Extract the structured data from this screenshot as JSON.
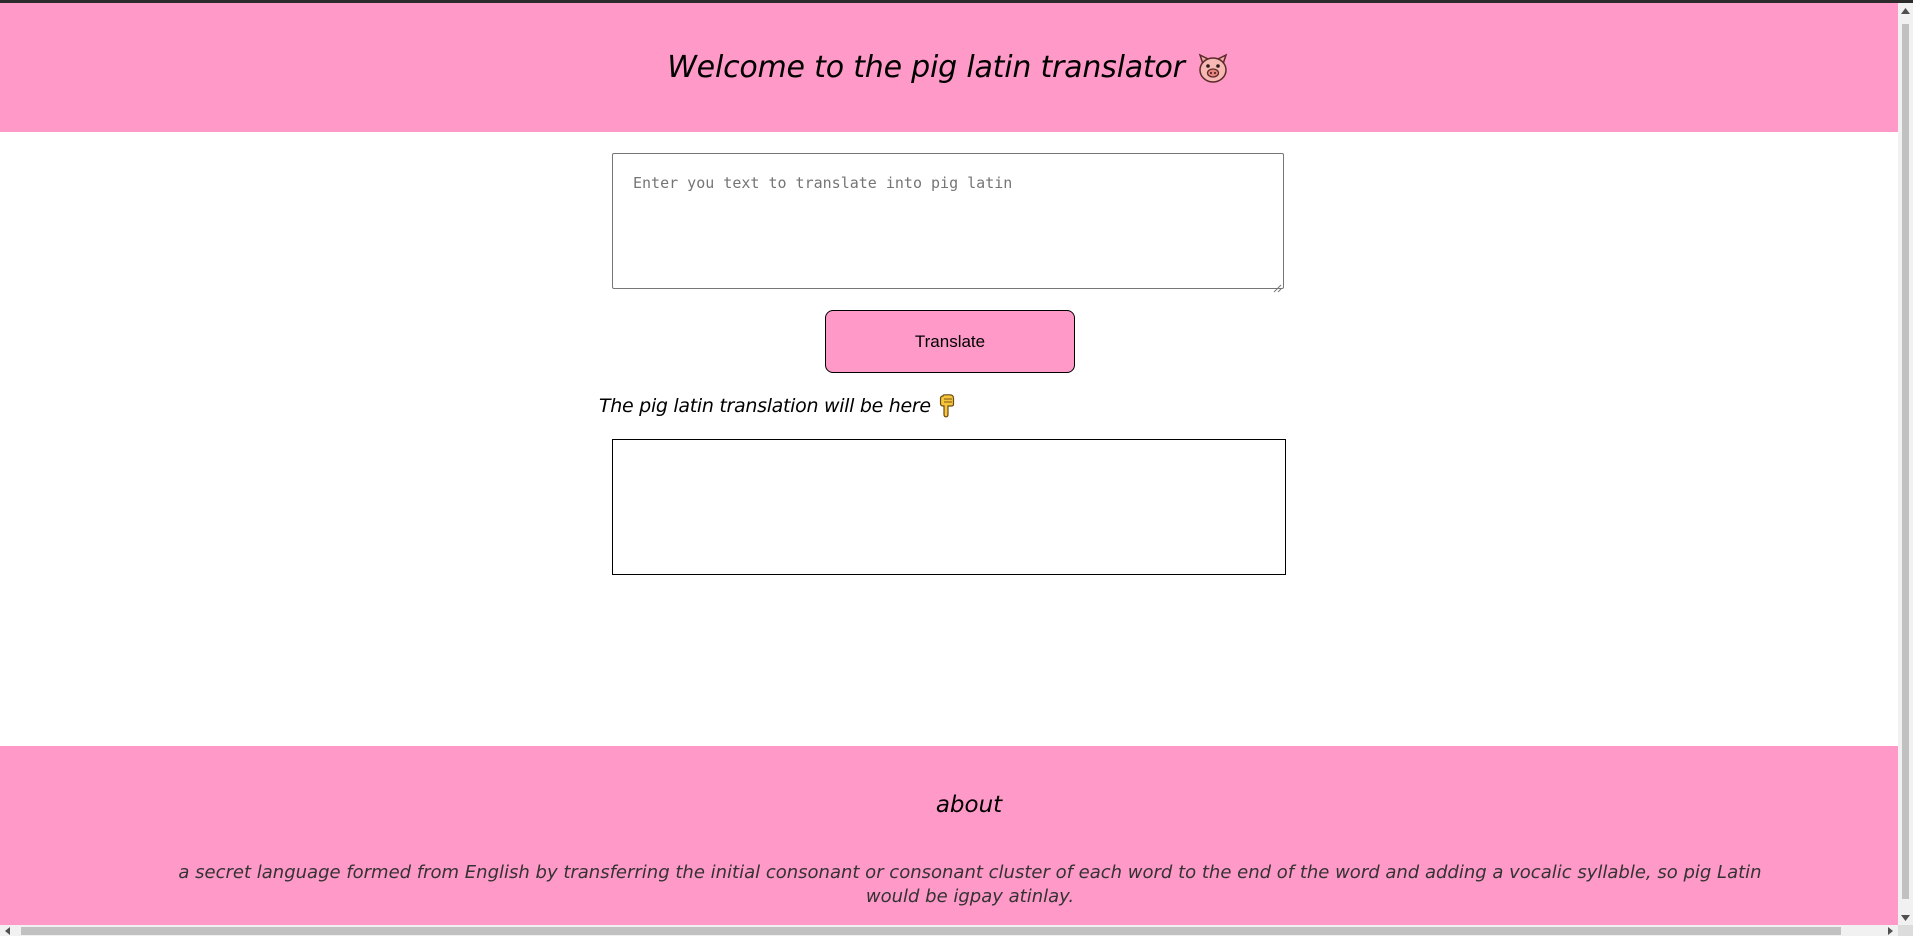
{
  "header": {
    "title": "Welcome to the pig latin translator",
    "icon": "pig-face-icon",
    "background_color": "#ff99c8"
  },
  "translator": {
    "input_placeholder": "Enter you text to translate into pig latin",
    "input_value": "",
    "button_label": "Translate",
    "button_color": "#ff99c8",
    "output_label": "The pig latin translation will be here",
    "output_label_icon": "pointing-down-hand-icon",
    "output_value": ""
  },
  "footer": {
    "heading": "about",
    "description": "a secret language formed from English by transferring the initial consonant or consonant cluster of each word to the end of the word and adding a vocalic syllable, so pig Latin would be igpay atinlay.",
    "background_color": "#ff99c8"
  }
}
